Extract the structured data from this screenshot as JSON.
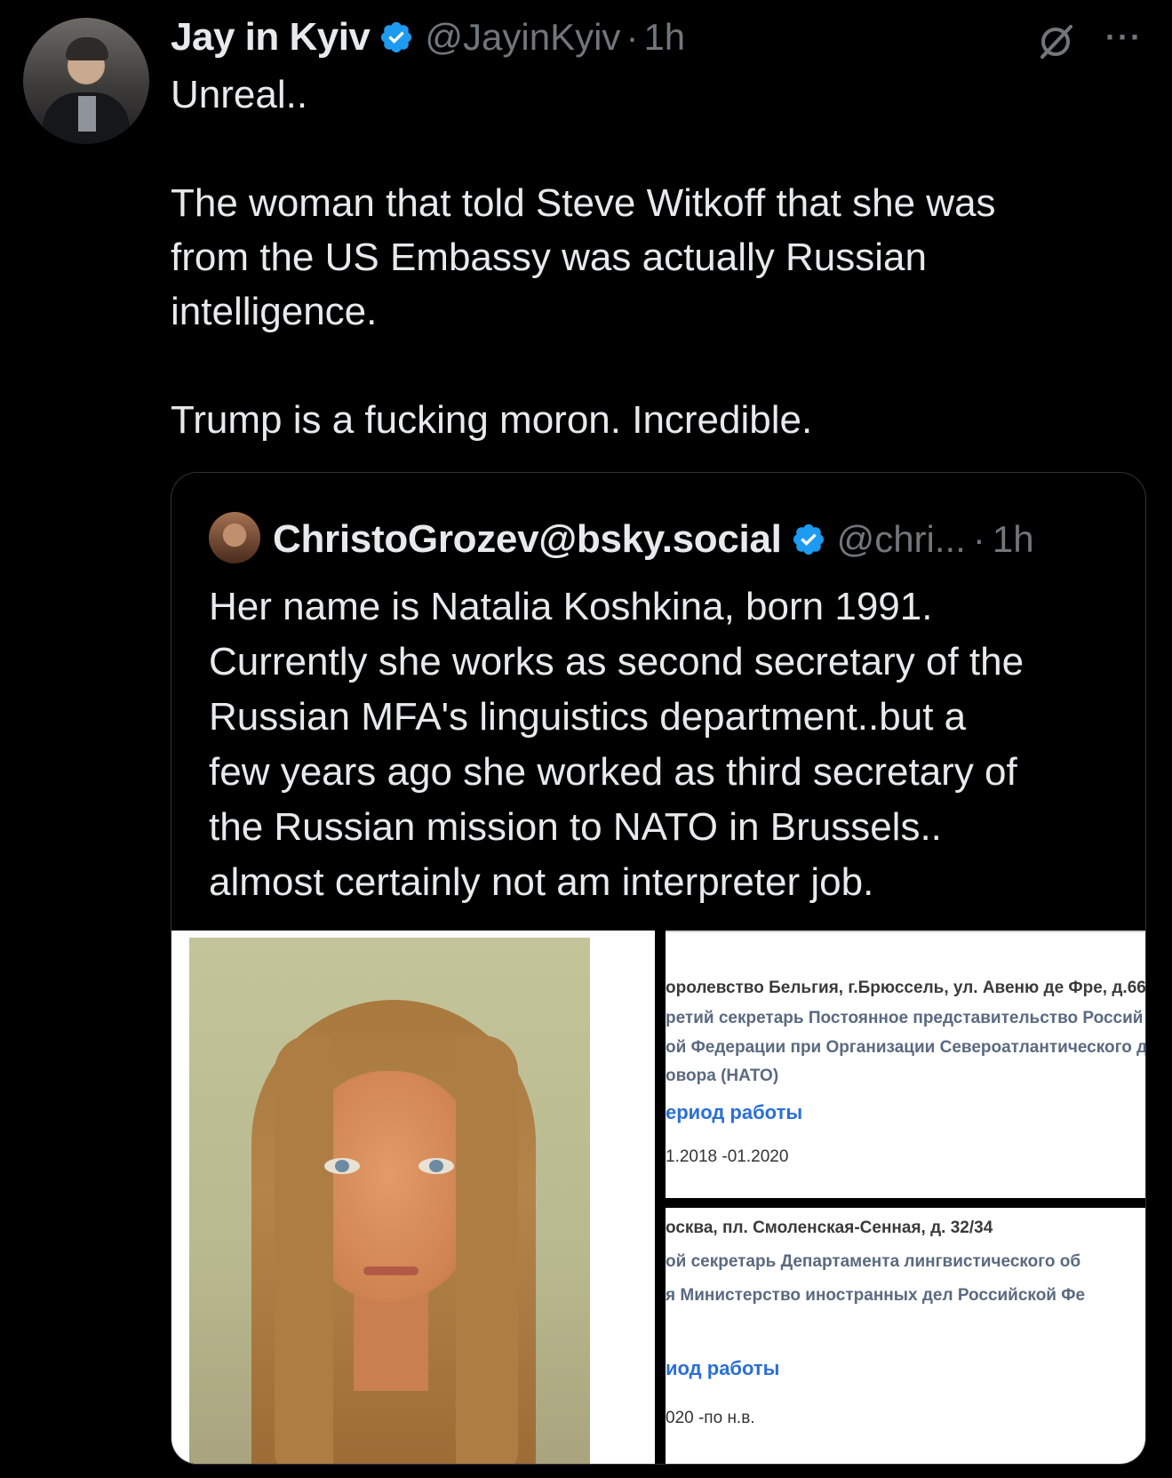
{
  "tweet": {
    "author_name": "Jay in Kyiv",
    "handle": "@JayinKyiv",
    "separator": "·",
    "time": "1h",
    "more_label": "···",
    "text": "Unreal..\n\nThe woman that told Steve Witkoff that she was\nfrom the US Embassy was actually Russian\nintelligence.\n\nTrump is a fucking moron. Incredible."
  },
  "quote": {
    "author_name": "ChristoGrozev@bsky.social",
    "handle": "@chri...",
    "separator": "·",
    "time": "1h",
    "text": "Her name is Natalia Koshkina, born 1991.\nCurrently she works as second secretary of the\nRussian MFA's linguistics department..but a\nfew years ago she worked as third secretary of\nthe Russian mission to NATO in Brussels..\nalmost certainly not am interpreter job."
  },
  "doc1": {
    "line1": "оролевство Бельгия, г.Брюссель, ул. Авеню де Фре, д.66",
    "line2": "ретий секретарь Постоянное представительство Россий",
    "line3": "ой Федерации при Организации Североатлантического д",
    "line4": "овора (НАТО)",
    "period_label": "ериод работы",
    "dates": "1.2018 -01.2020"
  },
  "doc2": {
    "line1": "осква, пл. Смоленская-Сенная, д. 32/34",
    "line2": "ой секретарь Департамента лингвистического об",
    "line3": "я Министерство иностранных дел Российской Фе",
    "period_label": "иод работы",
    "dates": "020 -по н.в."
  },
  "colors": {
    "background": "#000000",
    "text": "#e7e9ea",
    "secondary": "#71767b",
    "verified": "#1d9bf0",
    "border": "#2f3336"
  },
  "icons": [
    "verified-badge-icon",
    "grok-icon",
    "more-icon"
  ]
}
